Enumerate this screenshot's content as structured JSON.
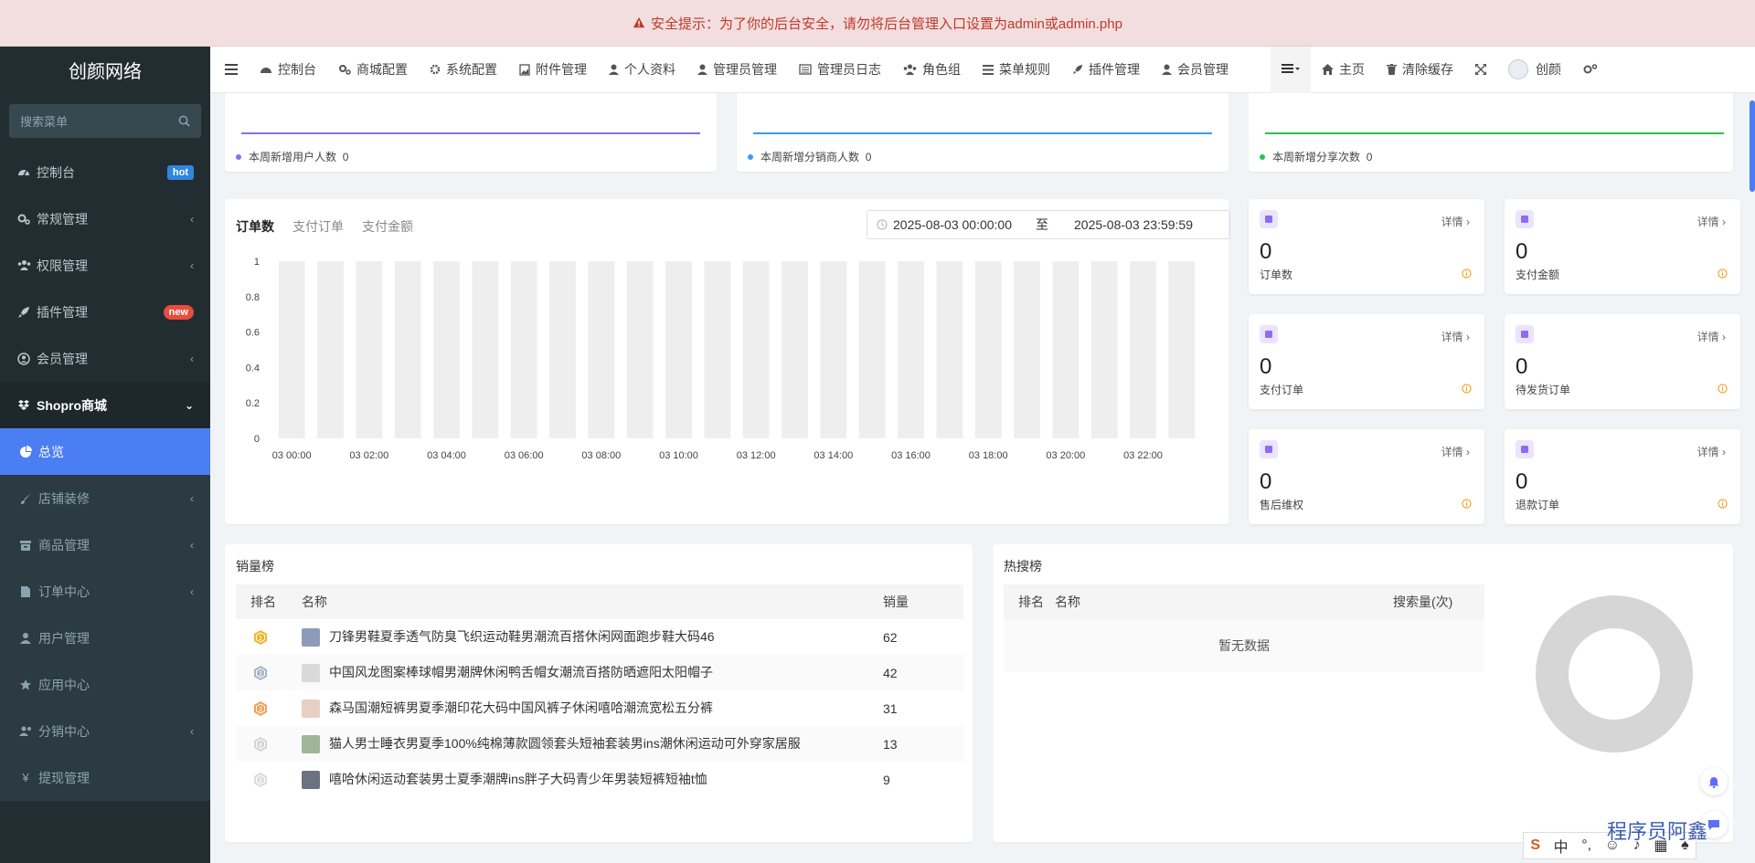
{
  "alert": {
    "text": "安全提示：为了你的后台安全，请勿将后台管理入口设置为admin或admin.php"
  },
  "sidebar": {
    "logo": "创颜网络",
    "search_placeholder": "搜索菜单",
    "items": [
      {
        "label": "控制台",
        "icon": "dashboard-icon",
        "badge": "hot"
      },
      {
        "label": "常规管理",
        "icon": "cogs-icon"
      },
      {
        "label": "权限管理",
        "icon": "group-icon"
      },
      {
        "label": "插件管理",
        "icon": "rocket-icon",
        "badge": "new"
      },
      {
        "label": "会员管理",
        "icon": "user-circle-icon"
      },
      {
        "label": "Shopro商城",
        "icon": "dropbox-icon"
      }
    ],
    "subitems": [
      {
        "label": "总览",
        "icon": "pie-chart-icon"
      },
      {
        "label": "店铺装修",
        "icon": "brush-icon"
      },
      {
        "label": "商品管理",
        "icon": "archive-icon"
      },
      {
        "label": "订单中心",
        "icon": "file-icon"
      },
      {
        "label": "用户管理",
        "icon": "user-icon"
      },
      {
        "label": "应用中心",
        "icon": "star-icon"
      },
      {
        "label": "分销中心",
        "icon": "users-icon"
      },
      {
        "label": "提现管理",
        "icon": "yen-icon"
      }
    ]
  },
  "topnav": {
    "items": [
      "控制台",
      "商城配置",
      "系统配置",
      "附件管理",
      "个人资料",
      "管理员管理",
      "管理员日志",
      "角色组",
      "菜单规则",
      "插件管理",
      "会员管理"
    ],
    "right": {
      "home": "主页",
      "clear_cache": "清除缓存",
      "user": "创颜"
    }
  },
  "week_stats": [
    {
      "label": "本周新增用户人数",
      "value": "0",
      "color": "#8c6ef0"
    },
    {
      "label": "本周新增分销商人数",
      "value": "0",
      "color": "#3b9cf0"
    },
    {
      "label": "本周新增分享次数",
      "value": "0",
      "color": "#2fbf4e"
    }
  ],
  "order_chart": {
    "tabs": [
      "订单数",
      "支付订单",
      "支付金额"
    ],
    "date_from": "2025-08-03 00:00:00",
    "date_sep": "至",
    "date_to": "2025-08-03 23:59:59"
  },
  "chart_data": {
    "type": "bar",
    "categories": [
      "03 00:00",
      "03 01:00",
      "03 02:00",
      "03 03:00",
      "03 04:00",
      "03 05:00",
      "03 06:00",
      "03 07:00",
      "03 08:00",
      "03 09:00",
      "03 10:00",
      "03 11:00",
      "03 12:00",
      "03 13:00",
      "03 14:00",
      "03 15:00",
      "03 16:00",
      "03 17:00",
      "03 18:00",
      "03 19:00",
      "03 20:00",
      "03 21:00",
      "03 22:00",
      "03 23:00"
    ],
    "values": [
      0,
      0,
      0,
      0,
      0,
      0,
      0,
      0,
      0,
      0,
      0,
      0,
      0,
      0,
      0,
      0,
      0,
      0,
      0,
      0,
      0,
      0,
      0,
      0
    ],
    "ylim": [
      0,
      1
    ],
    "yticks": [
      "0",
      "0.2",
      "0.4",
      "0.6",
      "0.8",
      "1"
    ],
    "xlabels_shown": [
      "03 00:00",
      "03 02:00",
      "03 04:00",
      "03 06:00",
      "03 08:00",
      "03 10:00",
      "03 12:00",
      "03 14:00",
      "03 16:00",
      "03 18:00",
      "03 20:00",
      "03 22:00"
    ],
    "background_bar_color": "#eeeeee"
  },
  "stat_cards": [
    {
      "value": "0",
      "label": "订单数",
      "detail": "详情"
    },
    {
      "value": "0",
      "label": "支付金额",
      "detail": "详情"
    },
    {
      "value": "0",
      "label": "支付订单",
      "detail": "详情"
    },
    {
      "value": "0",
      "label": "待发货订单",
      "detail": "详情"
    },
    {
      "value": "0",
      "label": "售后维权",
      "detail": "详情"
    },
    {
      "value": "0",
      "label": "退款订单",
      "detail": "详情"
    }
  ],
  "sales_rank": {
    "title": "销量榜",
    "headers": {
      "rank": "排名",
      "name": "名称",
      "sales": "销量"
    },
    "rows": [
      {
        "rank": "1",
        "name": "刀锋男鞋夏季透气防臭飞织运动鞋男潮流百搭休闲网面跑步鞋大码46",
        "sales": "62",
        "medal": "#f2b52d",
        "thumb": "#8e9bb8"
      },
      {
        "rank": "2",
        "name": "中国风龙图案棒球帽男潮牌休闲鸭舌帽女潮流百搭防晒遮阳太阳帽子",
        "sales": "42",
        "medal": "#a9b6c9",
        "thumb": "#d9d9d9"
      },
      {
        "rank": "3",
        "name": "森马国潮短裤男夏季潮印花大码中国风裤子休闲嘻哈潮流宽松五分裤",
        "sales": "31",
        "medal": "#f0a15a",
        "thumb": "#e8cfc4"
      },
      {
        "rank": "4",
        "name": "猫人男士睡衣男夏季100%纯棉薄款圆领套头短袖套装男ins潮休闲运动可外穿家居服",
        "sales": "13",
        "medal": "#d5d5d5",
        "thumb": "#9fb59a"
      },
      {
        "rank": "5",
        "name": "嘻哈休闲运动套装男士夏季潮牌ins胖子大码青少年男装短裤短袖t恤",
        "sales": "9",
        "medal": "#dcdcdc",
        "thumb": "#6b7280"
      }
    ]
  },
  "hot_search": {
    "title": "热搜榜",
    "headers": {
      "rank": "排名",
      "name": "名称",
      "count": "搜索量(次)"
    },
    "empty": "暂无数据"
  },
  "ime": {
    "label": "中"
  },
  "watermark": "程序员阿鑫"
}
